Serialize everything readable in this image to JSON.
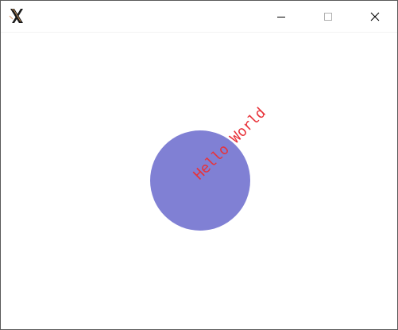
{
  "window": {
    "title": "",
    "controls": {
      "minimize_icon": "minimize-icon",
      "maximize_icon": "maximize-icon",
      "close_icon": "close-icon"
    },
    "app_icon": "x-logo-icon"
  },
  "canvas": {
    "circle_color": "#8080d4",
    "text": "Hello World",
    "text_color": "#e8333a",
    "text_rotation_deg": -45
  }
}
